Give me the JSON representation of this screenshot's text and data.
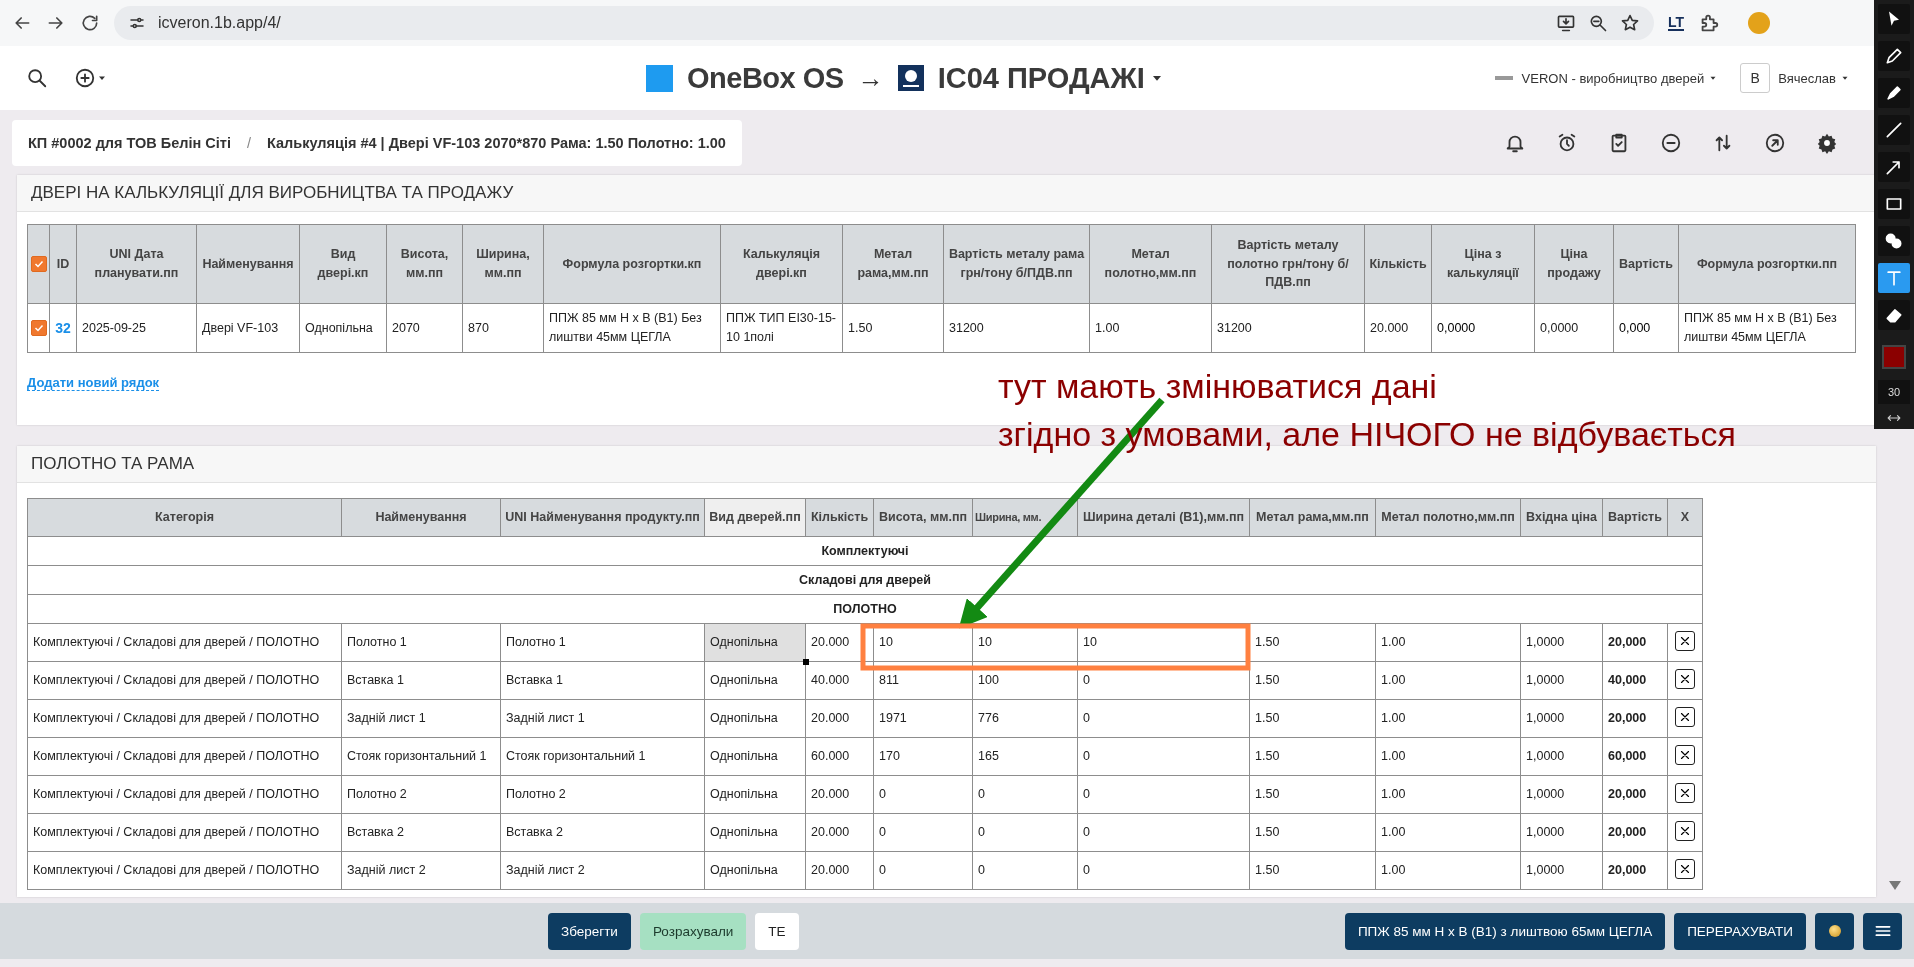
{
  "browser": {
    "url": "icveron.1b.app/4/",
    "extension_label": "LT"
  },
  "header": {
    "brand": "OneBox OS",
    "arrow": "→",
    "app": "IC04 ПРОДАЖІ",
    "company": "VERON - виробництво дверей",
    "user_initial": "В",
    "user": "Вячеслав"
  },
  "breadcrumb": {
    "items": [
      "КП #0002 для ТОВ Белін Сіті",
      "Калькуляція #4 | Двері VF-103 2070*870 Рама: 1.50 Полотно: 1.00"
    ],
    "separator": "/"
  },
  "doors_panel": {
    "title": "ДВЕРІ НА КАЛЬКУЛЯЦІЇ ДЛЯ ВИРОБНИЦТВА ТА ПРОДАЖУ",
    "all_checked": true,
    "columns": [
      "ID",
      "UNI Дата планувати.пп",
      "Найменування",
      "Вид двері.кп",
      "Висота, мм.пп",
      "Ширина, мм.пп",
      "Формула розгортки.кп",
      "Калькуляція двері.кп",
      "Метал рама,мм.пп",
      "Вартість металу рама грн/тону б/ПДВ.пп",
      "Метал полотно,мм.пп",
      "Вартість металу полотно грн/тону б/ПДВ.пп",
      "Кількість",
      "Ціна з калькуляції",
      "Ціна продажу",
      "Вартість",
      "Формула розгортки.пп"
    ],
    "rows": [
      {
        "checked": true,
        "cells": [
          "32",
          "2025-09-25",
          "Двері VF-103",
          "Однопільна",
          "2070",
          "870",
          "ППЖ 85 мм Н х В (В1) Без лиштви 45мм ЦЕГЛА",
          "ППЖ ТИП ЕІ30-15-10 1полі",
          "1.50",
          "31200",
          "1.00",
          "31200",
          "20.000",
          "0,0000",
          "0,0000",
          "0,000",
          "ППЖ 85 мм Н х В (В1) Без лиштви 45мм ЦЕГЛА"
        ]
      }
    ],
    "add_link": "Додати новий рядок"
  },
  "parts_panel": {
    "title": "ПОЛОТНО ТА РАМА",
    "columns": [
      {
        "label": "Категорія",
        "highlighted": false
      },
      {
        "label": "Найменування",
        "highlighted": false
      },
      {
        "label": "UNI Найменування продукту.пп",
        "highlighted": false
      },
      {
        "label": "Вид дверей.пп",
        "highlighted": true
      },
      {
        "label": "Кількість",
        "highlighted": false
      },
      {
        "label": "Висота, мм.пп",
        "highlighted": false
      },
      {
        "label": "Ширина, мм.",
        "highlighted": false
      },
      {
        "label": "Ширина деталі (В1),мм.пп",
        "highlighted": false
      },
      {
        "label": "Метал рама,мм.пп",
        "highlighted": false
      },
      {
        "label": "Метал полотно,мм.пп",
        "highlighted": false
      },
      {
        "label": "Вхідна ціна",
        "highlighted": false
      },
      {
        "label": "Вартість",
        "highlighted": false
      },
      {
        "label": "X",
        "highlighted": false
      }
    ],
    "rows": [
      {
        "kind": "group",
        "label": "Комплектуючі"
      },
      {
        "kind": "group",
        "label": "Складові для дверей"
      },
      {
        "kind": "group",
        "label": "ПОЛОТНО"
      },
      {
        "kind": "item",
        "selected": true,
        "cells": [
          "Комплектуючі / Складові для дверей / ПОЛОТНО",
          "Полотно 1",
          "Полотно 1",
          "Однопільна",
          "20.000",
          "10",
          "10",
          "10",
          "1.50",
          "1.00",
          "1,0000",
          "20,000"
        ]
      },
      {
        "kind": "item",
        "selected": false,
        "cells": [
          "Комплектуючі / Складові для дверей / ПОЛОТНО",
          "Вставка 1",
          "Вставка 1",
          "Однопільна",
          "40.000",
          "811",
          "100",
          "0",
          "1.50",
          "1.00",
          "1,0000",
          "40,000"
        ]
      },
      {
        "kind": "item",
        "selected": false,
        "cells": [
          "Комплектуючі / Складові для дверей / ПОЛОТНО",
          "Задній лист 1",
          "Задній лист 1",
          "Однопільна",
          "20.000",
          "1971",
          "776",
          "0",
          "1.50",
          "1.00",
          "1,0000",
          "20,000"
        ]
      },
      {
        "kind": "item",
        "selected": false,
        "cells": [
          "Комплектуючі / Складові для дверей / ПОЛОТНО",
          "Стояк горизонтальний 1",
          "Стояк горизонтальний 1",
          "Однопільна",
          "60.000",
          "170",
          "165",
          "0",
          "1.50",
          "1.00",
          "1,0000",
          "60,000"
        ]
      },
      {
        "kind": "item",
        "selected": false,
        "cells": [
          "Комплектуючі / Складові для дверей / ПОЛОТНО",
          "Полотно 2",
          "Полотно 2",
          "Однопільна",
          "20.000",
          "0",
          "0",
          "0",
          "1.50",
          "1.00",
          "1,0000",
          "20,000"
        ]
      },
      {
        "kind": "item",
        "selected": false,
        "cells": [
          "Комплектуючі / Складові для дверей / ПОЛОТНО",
          "Вставка 2",
          "Вставка 2",
          "Однопільна",
          "20.000",
          "0",
          "0",
          "0",
          "1.50",
          "1.00",
          "1,0000",
          "20,000"
        ]
      },
      {
        "kind": "item",
        "selected": false,
        "cells": [
          "Комплектуючі / Складові для дверей / ПОЛОТНО",
          "Задній лист 2",
          "Задній лист 2",
          "Однопільна",
          "20.000",
          "0",
          "0",
          "0",
          "1.50",
          "1.00",
          "1,0000",
          "20,000"
        ]
      }
    ]
  },
  "annotation": {
    "lines": [
      "тут мають змінюватися дані",
      "згідно з умовами, але НІЧОГО не відбувається"
    ]
  },
  "toolbar": {
    "tools": [
      {
        "kind": "cursor",
        "selected": false
      },
      {
        "kind": "pencil",
        "selected": false
      },
      {
        "kind": "marker",
        "selected": false
      },
      {
        "kind": "line",
        "selected": false
      },
      {
        "kind": "arrow",
        "selected": false
      },
      {
        "kind": "rectangle",
        "selected": false
      },
      {
        "kind": "numbers",
        "selected": false
      },
      {
        "kind": "text",
        "selected": true
      },
      {
        "kind": "eraser",
        "selected": false
      }
    ],
    "brush_size": "30"
  },
  "bottom_bar": {
    "left_buttons": [
      {
        "label": "Зберегти",
        "kind": "primary"
      },
      {
        "label": "Розрахували",
        "kind": "success"
      },
      {
        "label": "ТЕ",
        "kind": "plain"
      }
    ],
    "right_buttons": [
      {
        "label": "ППЖ 85 мм Н х В (В1) з лиштвою 65мм ЦЕГЛА",
        "kind": "primary"
      },
      {
        "label": "ПЕРЕРАХУВАТИ",
        "kind": "primary"
      }
    ]
  }
}
